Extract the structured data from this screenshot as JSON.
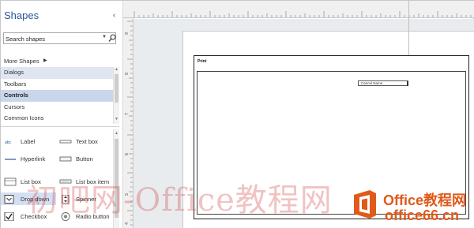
{
  "pane": {
    "title": "Shapes",
    "collapse_glyph": "‹",
    "search_placeholder": "Search shapes",
    "more_shapes": "More Shapes",
    "stencils": [
      {
        "label": "Dialogs"
      },
      {
        "label": "Toolbars"
      },
      {
        "label": "Controls"
      },
      {
        "label": "Cursors"
      },
      {
        "label": "Common Icons"
      }
    ],
    "shapes": [
      {
        "label": "Label",
        "icon": "label-icon"
      },
      {
        "label": "Text box",
        "icon": "text-box-icon"
      },
      {
        "label": "Hyperlink",
        "icon": "hyperlink-icon"
      },
      {
        "label": "Button",
        "icon": "button-icon"
      },
      {
        "label": "List box",
        "icon": "list-box-icon"
      },
      {
        "label": "List box item",
        "icon": "list-box-item-icon"
      },
      {
        "label": "Drop down",
        "icon": "drop-down-icon"
      },
      {
        "label": "Spinner",
        "icon": "spinner-icon"
      },
      {
        "label": "Checkbox",
        "icon": "checkbox-icon"
      },
      {
        "label": "Radio button",
        "icon": "radio-button-icon"
      }
    ]
  },
  "ruler": {
    "left_labels": [
      "9",
      "8",
      "7",
      "6",
      "5",
      "4"
    ]
  },
  "drawing": {
    "frame_title": "Print",
    "control_text": "Cancel Name"
  },
  "watermark": {
    "text": "初吧网-Office教程网",
    "brand_top": "Office教程网",
    "brand_bottom": "office66.cn"
  },
  "colors": {
    "accent": "#2b579a",
    "selection": "#c9d6ec",
    "watermark_orange": "#e05a1a"
  }
}
